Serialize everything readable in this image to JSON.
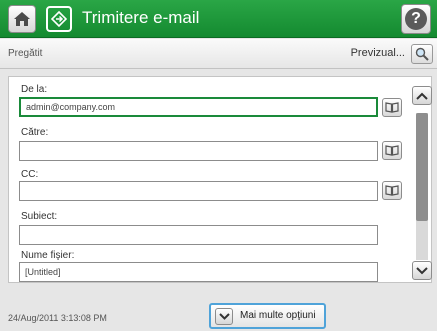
{
  "header": {
    "title": "Trimitere e-mail",
    "home_icon": "home-icon",
    "app_icon": "email-send-icon",
    "help_icon": "help-icon",
    "help_glyph": "?"
  },
  "status": {
    "text": "Pregătit",
    "preview_label": "Previzual...",
    "preview_icon": "magnifier-icon"
  },
  "form": {
    "from_label": "De la:",
    "from_value": "admin@company.com",
    "to_label": "Către:",
    "to_value": "",
    "cc_label": "CC:",
    "cc_value": "",
    "subject_label": "Subiect:",
    "subject_value": "",
    "filename_label": "Nume fişier:",
    "filename_value": "[Untitled]"
  },
  "footer": {
    "timestamp": "24/Aug/2011 3:13:08 PM",
    "more_options_label": "Mai multe opţiuni"
  },
  "colors": {
    "header_green": "#1f9a3c",
    "active_border": "#1a8a3a",
    "more_button_border": "#4fa3d9"
  }
}
